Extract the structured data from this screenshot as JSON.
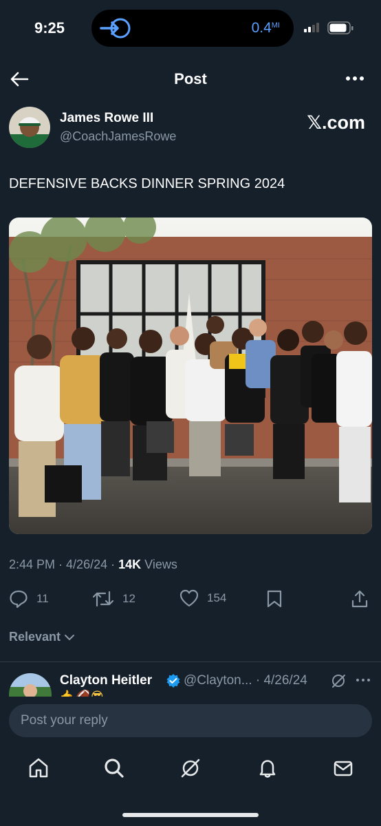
{
  "status_bar": {
    "time": "9:25",
    "nav_distance": "0.4",
    "nav_unit": "MI",
    "accent_color": "#5aa0ff"
  },
  "header": {
    "title": "Post",
    "back_icon": "arrow-left-icon",
    "more_icon": "more-horizontal-icon"
  },
  "post": {
    "author_name": "James Rowe III",
    "author_handle": "@CoachJamesRowe",
    "source_label": "𝕏.com",
    "text": "DEFENSIVE BACKS DINNER SPRING 2024",
    "image": "group-photo",
    "time": "2:44 PM",
    "date": "4/26/24",
    "views_count": "14K",
    "views_label": "Views",
    "stats": {
      "replies": "11",
      "reposts": "12",
      "likes": "154"
    }
  },
  "replies_section": {
    "sort_label": "Relevant",
    "items": [
      {
        "name": "Clayton Heitler",
        "handle": "@Clayton...",
        "date": "4/26/24",
        "verified": true,
        "emoji": "🤙🏈😎"
      }
    ]
  },
  "composer": {
    "placeholder": "Post your reply"
  },
  "tabbar": {
    "items": [
      "home-icon",
      "search-icon",
      "grok-icon",
      "notifications-icon",
      "messages-icon"
    ]
  }
}
